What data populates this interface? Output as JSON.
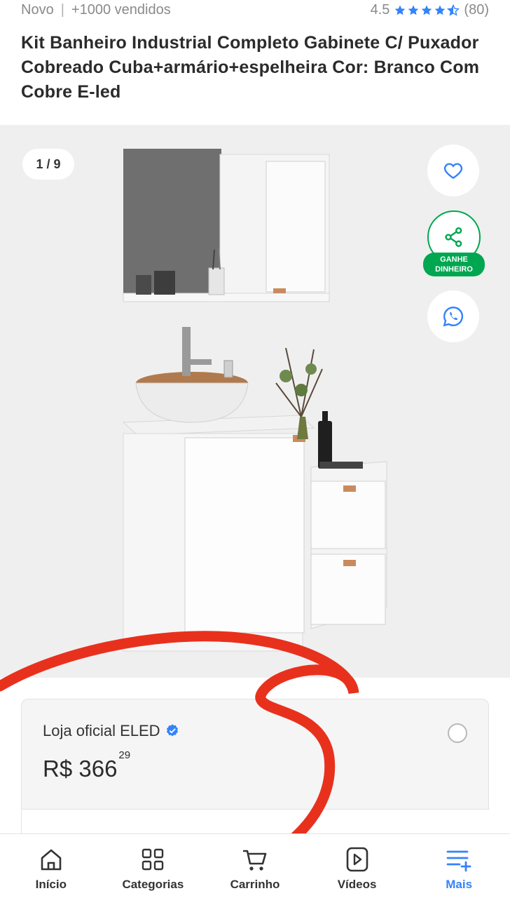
{
  "header": {
    "condition": "Novo",
    "separator": "|",
    "sold": "+1000 vendidos",
    "rating": "4.5",
    "rating_value": 4.5,
    "reviews": "(80)"
  },
  "product": {
    "title": "Kit Banheiro Industrial Completo Gabinete C/ Puxador Cobreado Cuba+armário+espelheira Cor: Branco Com Cobre E-led"
  },
  "gallery": {
    "counter": "1 / 9",
    "share_badge_line1": "GANHE",
    "share_badge_line2": "DINHEIRO"
  },
  "offer": {
    "seller": "Loja oficial ELED",
    "currency": "R$",
    "price_int": "366",
    "price_cents": "29"
  },
  "nav": {
    "items": [
      {
        "label": "Início",
        "icon": "home-icon"
      },
      {
        "label": "Categorias",
        "icon": "categories-icon"
      },
      {
        "label": "Carrinho",
        "icon": "cart-icon"
      },
      {
        "label": "Vídeos",
        "icon": "video-icon"
      },
      {
        "label": "Mais",
        "icon": "menu-plus-icon"
      }
    ]
  },
  "colors": {
    "accent": "#3483fa",
    "green": "#00a650",
    "annotation": "#e8311d"
  }
}
